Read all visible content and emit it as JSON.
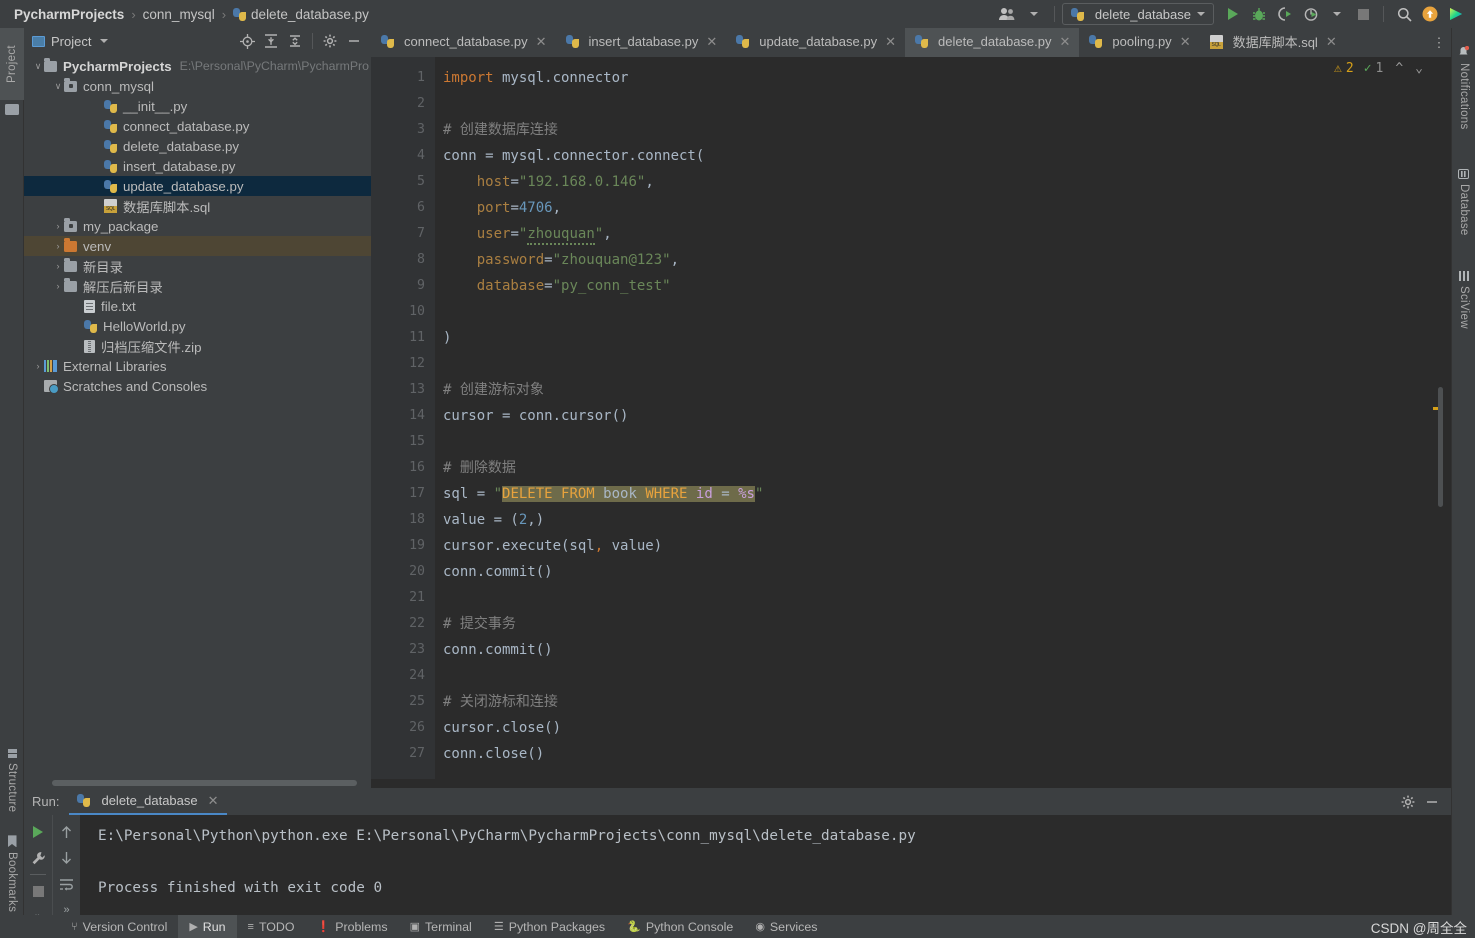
{
  "breadcrumb": {
    "root": "PycharmProjects",
    "folder": "conn_mysql",
    "file": "delete_database.py",
    "sep": "›"
  },
  "toolbar": {
    "run_config_label": "delete_database",
    "icons": [
      {
        "name": "user-accounts-icon",
        "glyph": "👤"
      },
      {
        "name": "run-icon",
        "glyph": "▶"
      },
      {
        "name": "debug-icon",
        "glyph": "🐞"
      },
      {
        "name": "run-coverage-icon",
        "glyph": "➤"
      },
      {
        "name": "profile-icon",
        "glyph": "◴"
      },
      {
        "name": "stop-icon",
        "glyph": "■"
      },
      {
        "name": "search-everywhere-icon",
        "glyph": "🔍"
      },
      {
        "name": "updates-icon",
        "glyph": "↑"
      },
      {
        "name": "ide-logo-icon",
        "glyph": "▶"
      }
    ]
  },
  "left_strip": [
    {
      "name": "project",
      "label": "Project",
      "active": true
    },
    {
      "name": "structure",
      "label": "Structure",
      "active": false
    },
    {
      "name": "bookmarks",
      "label": "Bookmarks",
      "active": false
    }
  ],
  "right_strip": [
    {
      "name": "notifications",
      "label": "Notifications"
    },
    {
      "name": "database",
      "label": "Database"
    },
    {
      "name": "sciview",
      "label": "SciView"
    }
  ],
  "project_panel": {
    "title": "Project",
    "tools": [
      "select-opened-file-icon",
      "expand-all-icon",
      "collapse-all-icon",
      "settings-gear-icon",
      "hide-panel-icon"
    ],
    "tree": [
      {
        "label": "PycharmProjects",
        "note": "E:\\Personal\\PyCharm\\PycharmPro",
        "icon": "folder",
        "indent": 0,
        "arrow": "∨",
        "bold": true,
        "state": "none"
      },
      {
        "label": "conn_mysql",
        "note": "",
        "icon": "package",
        "indent": 1,
        "arrow": "∨",
        "bold": false,
        "state": "none"
      },
      {
        "label": "__init__.py",
        "note": "",
        "icon": "python",
        "indent": 3,
        "arrow": "",
        "bold": false,
        "state": "none"
      },
      {
        "label": "connect_database.py",
        "note": "",
        "icon": "python",
        "indent": 3,
        "arrow": "",
        "bold": false,
        "state": "none"
      },
      {
        "label": "delete_database.py",
        "note": "",
        "icon": "python",
        "indent": 3,
        "arrow": "",
        "bold": false,
        "state": "none"
      },
      {
        "label": "insert_database.py",
        "note": "",
        "icon": "python",
        "indent": 3,
        "arrow": "",
        "bold": false,
        "state": "none"
      },
      {
        "label": "update_database.py",
        "note": "",
        "icon": "python",
        "indent": 3,
        "arrow": "",
        "bold": false,
        "state": "selected"
      },
      {
        "label": "数据库脚本.sql",
        "note": "",
        "icon": "sql",
        "indent": 3,
        "arrow": "",
        "bold": false,
        "state": "none"
      },
      {
        "label": "my_package",
        "note": "",
        "icon": "package",
        "indent": 1,
        "arrow": "›",
        "bold": false,
        "state": "none"
      },
      {
        "label": "venv",
        "note": "",
        "icon": "folder-orange",
        "indent": 1,
        "arrow": "›",
        "bold": false,
        "state": "highlight"
      },
      {
        "label": "新目录",
        "note": "",
        "icon": "folder",
        "indent": 1,
        "arrow": "›",
        "bold": false,
        "state": "none"
      },
      {
        "label": "解压后新目录",
        "note": "",
        "icon": "folder",
        "indent": 1,
        "arrow": "›",
        "bold": false,
        "state": "none"
      },
      {
        "label": "file.txt",
        "note": "",
        "icon": "txt",
        "indent": 2,
        "arrow": "",
        "bold": false,
        "state": "none"
      },
      {
        "label": "HelloWorld.py",
        "note": "",
        "icon": "python",
        "indent": 2,
        "arrow": "",
        "bold": false,
        "state": "none"
      },
      {
        "label": "归档压缩文件.zip",
        "note": "",
        "icon": "zip",
        "indent": 2,
        "arrow": "",
        "bold": false,
        "state": "none"
      },
      {
        "label": "External Libraries",
        "note": "",
        "icon": "lib",
        "indent": 0,
        "arrow": "›",
        "bold": false,
        "state": "none"
      },
      {
        "label": "Scratches and Consoles",
        "note": "",
        "icon": "scratch",
        "indent": 0,
        "arrow": "",
        "bold": false,
        "state": "none"
      }
    ]
  },
  "editor": {
    "tabs": [
      {
        "label": "connect_database.py",
        "icon": "python",
        "active": false
      },
      {
        "label": "insert_database.py",
        "icon": "python",
        "active": false
      },
      {
        "label": "update_database.py",
        "icon": "python",
        "active": false
      },
      {
        "label": "delete_database.py",
        "icon": "python",
        "active": true
      },
      {
        "label": "pooling.py",
        "icon": "python",
        "active": false
      },
      {
        "label": "数据库脚本.sql",
        "icon": "sql",
        "active": false
      }
    ],
    "inspection": {
      "warnings": "2",
      "ok": "1"
    },
    "line_numbers": [
      "1",
      "2",
      "3",
      "4",
      "5",
      "6",
      "7",
      "8",
      "9",
      "10",
      "11",
      "12",
      "13",
      "14",
      "15",
      "16",
      "17",
      "18",
      "19",
      "20",
      "21",
      "22",
      "23",
      "24",
      "25",
      "26",
      "27"
    ],
    "code_lines": [
      "import mysql.connector",
      "",
      "# 创建数据库连接",
      "conn = mysql.connector.connect(",
      "    host=\"192.168.0.146\",",
      "    port=4706,",
      "    user=\"zhouquan\",",
      "    password=\"zhouquan@123\",",
      "    database=\"py_conn_test\"",
      "",
      ")",
      "",
      "# 创建游标对象",
      "cursor = conn.cursor()",
      "",
      "# 删除数据",
      "sql = \"DELETE FROM book WHERE id = %s\"",
      "value = (2,)",
      "cursor.execute(sql, value)",
      "conn.commit()",
      "",
      "# 提交事务",
      "conn.commit()",
      "",
      "# 关闭游标和连接",
      "cursor.close()",
      "conn.close()"
    ]
  },
  "run_panel": {
    "label": "Run:",
    "tab_label": "delete_database",
    "tools_left": [
      "rerun-icon",
      "settings-wrench-icon",
      "stop-icon",
      "expand-icon"
    ],
    "tools_right": [
      "scroll-up-icon",
      "scroll-down-icon",
      "soft-wrap-icon",
      "expand2-icon"
    ],
    "header_icons": [
      "settings-gear-icon",
      "hide-panel-icon"
    ],
    "console_lines": [
      "E:\\Personal\\Python\\python.exe E:\\Personal\\PyCharm\\PycharmProjects\\conn_mysql\\delete_database.py",
      "",
      "Process finished with exit code 0"
    ]
  },
  "status_bar": {
    "items": [
      {
        "name": "version-control",
        "label": "Version Control",
        "icon": "branch-icon",
        "active": false
      },
      {
        "name": "run",
        "label": "Run",
        "icon": "play-icon",
        "active": true
      },
      {
        "name": "todo",
        "label": "TODO",
        "icon": "list-icon",
        "active": false
      },
      {
        "name": "problems",
        "label": "Problems",
        "icon": "exclamation-icon",
        "active": false
      },
      {
        "name": "terminal",
        "label": "Terminal",
        "icon": "terminal-icon",
        "active": false
      },
      {
        "name": "python-packages",
        "label": "Python Packages",
        "icon": "packages-icon",
        "active": false
      },
      {
        "name": "python-console",
        "label": "Python Console",
        "icon": "python-icon",
        "active": false
      },
      {
        "name": "services",
        "label": "Services",
        "icon": "services-icon",
        "active": false
      }
    ],
    "watermark": "CSDN @周全全"
  },
  "colors": {
    "bg": "#3c3f41",
    "editor_bg": "#2b2b2b",
    "gutter_bg": "#313335",
    "accent": "#4a88c7",
    "keyword": "#cc7832",
    "string": "#6a8759",
    "number": "#6897bb",
    "comment": "#808080",
    "selection": "#0d293e"
  }
}
